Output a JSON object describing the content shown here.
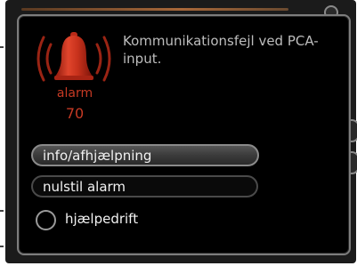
{
  "alarm": {
    "label": "alarm",
    "code": "70",
    "icon": "alarm-bell-icon",
    "color": "#c63a24"
  },
  "message": "Kommunikationsfejl ved PCA-input.",
  "actions": {
    "info_label": "info/afhjælpning",
    "reset_label": "nulstil alarm"
  },
  "option": {
    "label": "hjælpedrift",
    "selected": false
  }
}
